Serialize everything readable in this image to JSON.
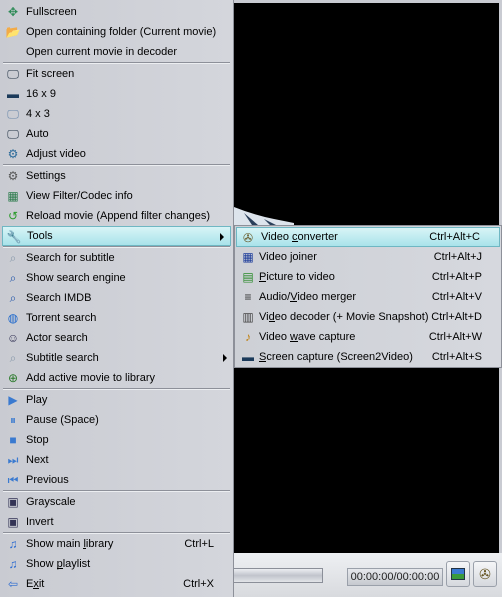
{
  "menu": {
    "sections": [
      [
        {
          "label": "Fullscreen",
          "icon": "fullscreen-icon",
          "glyph": "✥",
          "color": "#2e8b57"
        },
        {
          "label": "Open containing folder (Current movie)",
          "icon": "folder-icon",
          "glyph": "📂",
          "color": "#e0b030"
        },
        {
          "label": "Open current movie in decoder",
          "icon": "",
          "glyph": "",
          "color": ""
        }
      ],
      [
        {
          "label": "Fit screen",
          "icon": "fit-screen-icon",
          "glyph": "🖵",
          "color": "#234"
        },
        {
          "label": "16 x 9",
          "icon": "widescreen-icon",
          "glyph": "▬",
          "color": "#1b3a5a"
        },
        {
          "label": "4 x 3",
          "icon": "monitor-icon",
          "glyph": "🖵",
          "color": "#6a88aa"
        },
        {
          "label": "Auto",
          "icon": "auto-monitor-icon",
          "glyph": "🖵",
          "color": "#234"
        },
        {
          "label": "Adjust video",
          "icon": "adjust-video-icon",
          "glyph": "⚙",
          "color": "#2a6a9a"
        }
      ],
      [
        {
          "label": "Settings",
          "icon": "settings-icon",
          "glyph": "⚙",
          "color": "#555"
        },
        {
          "label": "View Filter/Codec info",
          "icon": "filter-info-icon",
          "glyph": "▦",
          "color": "#2a7a4a"
        },
        {
          "label": "Reload movie (Append filter changes)",
          "icon": "reload-icon",
          "glyph": "↺",
          "color": "#2a9a2a"
        },
        {
          "label": "Tools",
          "icon": "tools-icon",
          "glyph": "🔧",
          "color": "#b03030",
          "submenu": true,
          "highlighted": true
        }
      ],
      [
        {
          "label": "Search for subtitle",
          "icon": "subtitle-search-icon",
          "glyph": "⌕",
          "color": "#8899aa"
        },
        {
          "label": "Show search engine",
          "icon": "search-engine-icon",
          "glyph": "⌕",
          "color": "#2255aa"
        },
        {
          "label": "Search IMDB",
          "icon": "imdb-icon",
          "glyph": "⌕",
          "color": "#2255aa"
        },
        {
          "label": "Torrent search",
          "icon": "globe-icon",
          "glyph": "◍",
          "color": "#1a66cc"
        },
        {
          "label": "Actor search",
          "icon": "actor-icon",
          "glyph": "☺",
          "color": "#335"
        },
        {
          "label": "Subtitle search",
          "icon": "subtitle-icon",
          "glyph": "⌕",
          "color": "#8899aa",
          "submenu": true
        },
        {
          "label": "Add active movie to library",
          "icon": "add-library-icon",
          "glyph": "⊕",
          "color": "#2a7a2a"
        }
      ],
      [
        {
          "label": "Play",
          "icon": "play-icon",
          "glyph": "▶",
          "color": "#3a7ad0"
        },
        {
          "label": "Pause (Space)",
          "icon": "pause-icon",
          "glyph": "⏸",
          "color": "#3a7ad0"
        },
        {
          "label": "Stop",
          "icon": "stop-icon",
          "glyph": "■",
          "color": "#3a7ad0"
        },
        {
          "label": "Next",
          "icon": "next-icon",
          "glyph": "⏭",
          "color": "#3a7ad0"
        },
        {
          "label": "Previous",
          "icon": "previous-icon",
          "glyph": "⏮",
          "color": "#3a7ad0"
        }
      ],
      [
        {
          "label": "Grayscale",
          "icon": "grayscale-icon",
          "glyph": "▣",
          "color": "#335"
        },
        {
          "label": "Invert",
          "icon": "invert-icon",
          "glyph": "▣",
          "color": "#335"
        }
      ],
      [
        {
          "label": "Show main library",
          "mnemonic": "l",
          "shortcut": "Ctrl+L",
          "icon": "library-icon",
          "glyph": "♫",
          "color": "#2a6ad0"
        },
        {
          "label": "Show playlist",
          "mnemonic": "p",
          "icon": "playlist-icon",
          "glyph": "♫",
          "color": "#2a6ad0"
        },
        {
          "label": "Exit",
          "mnemonic": "x",
          "shortcut": "Ctrl+X",
          "icon": "exit-icon",
          "glyph": "⇦",
          "color": "#2a6ad0"
        }
      ]
    ]
  },
  "tools_submenu": [
    {
      "label": "Video converter",
      "mnemonic": "c",
      "shortcut": "Ctrl+Alt+C",
      "icon": "film-reel-icon",
      "glyph": "✇",
      "color": "#665522",
      "highlighted": true
    },
    {
      "label": "Video joiner",
      "shortcut": "Ctrl+Alt+J",
      "icon": "film-strip-icon",
      "glyph": "▦",
      "color": "#1a3a9a"
    },
    {
      "label": "Picture to video",
      "mnemonic": "P",
      "shortcut": "Ctrl+Alt+P",
      "icon": "picture-add-icon",
      "glyph": "▤",
      "color": "#2a8a2a"
    },
    {
      "label": "Audio/Video merger",
      "mnemonic": "V",
      "shortcut": "Ctrl+Alt+V",
      "icon": "merger-icon",
      "glyph": "≡",
      "color": "#333"
    },
    {
      "label": "Video decoder (+ Movie Snapshot)",
      "mnemonic": "d",
      "shortcut": "Ctrl+Alt+D",
      "icon": "clapper-icon",
      "glyph": "▥",
      "color": "#444"
    },
    {
      "label": "Video wave capture",
      "mnemonic": "w",
      "shortcut": "Ctrl+Alt+W",
      "icon": "wave-capture-icon",
      "glyph": "♪",
      "color": "#c08010"
    },
    {
      "label": "Screen capture (Screen2Video)",
      "mnemonic": "S",
      "shortcut": "Ctrl+Alt+S",
      "icon": "screen-capture-icon",
      "glyph": "▬",
      "color": "#1b3a5a"
    }
  ],
  "player": {
    "time": "00:00:00/00:00:00"
  }
}
